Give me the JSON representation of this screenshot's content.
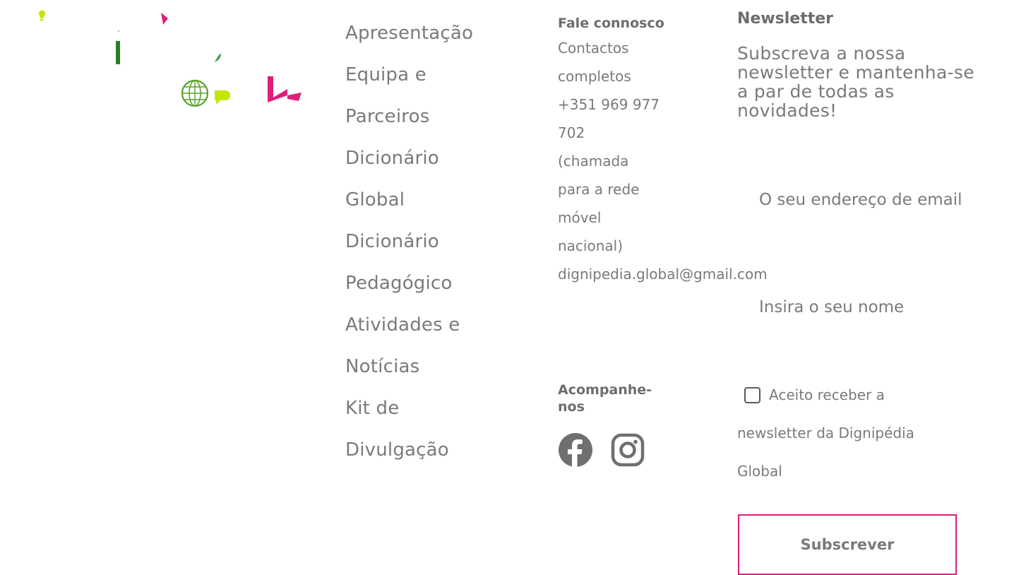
{
  "nav": {
    "items": [
      {
        "lines": [
          "Apresentação"
        ]
      },
      {
        "lines": [
          "Equipa e",
          "Parceiros"
        ]
      },
      {
        "lines": [
          "Dicionário",
          "Global"
        ]
      },
      {
        "lines": [
          "Dicionário",
          "Pedagógico"
        ]
      },
      {
        "lines": [
          "Atividades e",
          "Notícias"
        ]
      },
      {
        "lines": [
          "Kit de",
          "Divulgação"
        ]
      }
    ]
  },
  "contact": {
    "title": "Fale connosco",
    "lines": [
      "Contactos",
      "completos",
      "+351 969 977",
      "702",
      "(chamada",
      "para a rede",
      "móvel",
      "nacional)"
    ],
    "email": "dignipedia.global@gmail.com"
  },
  "follow": {
    "title_line1": "Acompanhe-",
    "title_line2": "nos",
    "icons": [
      "facebook-icon",
      "instagram-icon"
    ]
  },
  "newsletter": {
    "title": "Newsletter",
    "description": "Subscreva a nossa newsletter e mantenha-se a par de todas as novidades!",
    "email_placeholder": "O seu endereço de email",
    "name_placeholder": "Insira o seu nome",
    "consent_line1": "Aceito receber a",
    "consent_line2": "newsletter da Dignipédia",
    "consent_line3": "Global",
    "subscribe_label": "Subscrever"
  },
  "colors": {
    "accent": "#e01e7a",
    "lime": "#c6e600",
    "green": "#5aa02c",
    "text": "#7a7a7a"
  }
}
